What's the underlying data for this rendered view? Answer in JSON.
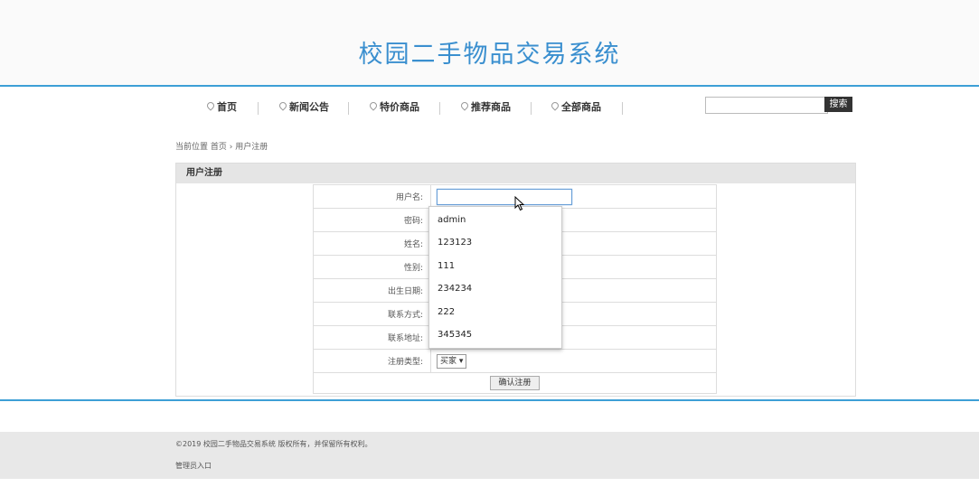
{
  "site": {
    "title": "校园二手物品交易系统"
  },
  "nav": {
    "items": [
      {
        "label": "首页"
      },
      {
        "label": "新闻公告"
      },
      {
        "label": "特价商品"
      },
      {
        "label": "推荐商品"
      },
      {
        "label": "全部商品"
      }
    ]
  },
  "search": {
    "value": "",
    "button_label": "搜索"
  },
  "breadcrumb": {
    "prefix": "当前位置",
    "home": "首页",
    "separator": "›",
    "current": "用户注册"
  },
  "panel": {
    "title": "用户注册"
  },
  "form": {
    "fields": [
      {
        "label": "用户名:"
      },
      {
        "label": "密码:"
      },
      {
        "label": "姓名:"
      },
      {
        "label": "性别:"
      },
      {
        "label": "出生日期:"
      },
      {
        "label": "联系方式:"
      },
      {
        "label": "联系地址:"
      },
      {
        "label": "注册类型:"
      }
    ],
    "username_value": "",
    "register_type_selected": "买家",
    "submit_label": "确认注册"
  },
  "autocomplete": {
    "suggestions": [
      "admin",
      "123123",
      "111",
      "234234",
      "222",
      "345345"
    ]
  },
  "footer": {
    "copyright": "©2019 校园二手物品交易系统 版权所有，并保留所有权利。",
    "admin_link": "管理员入口"
  },
  "colors": {
    "accent": "#3d9fd6",
    "title": "#3a8fcf",
    "panel_header": "#e5e5e5",
    "footer_bg": "#e8e8e8"
  }
}
